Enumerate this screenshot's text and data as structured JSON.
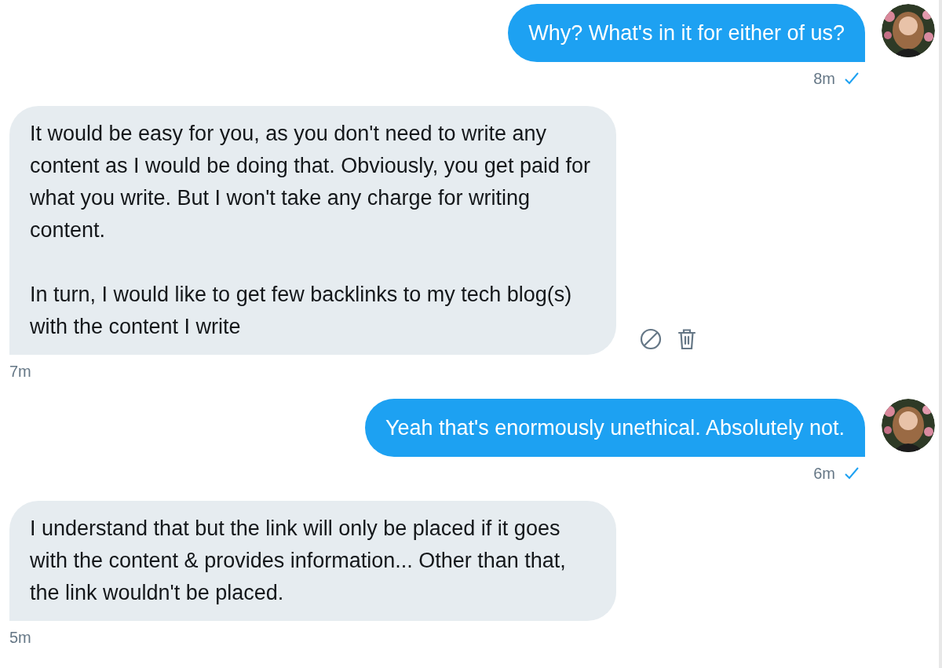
{
  "messages": [
    {
      "kind": "sent",
      "paragraphs": [
        "Why? What's in it for either of us?"
      ],
      "time": "8m",
      "read": true,
      "show_actions": false
    },
    {
      "kind": "received",
      "paragraphs": [
        "It would be easy for you, as you don't need to write any content as I would be doing that. Obviously, you get paid for what you write. But I won't take any charge for writing content.",
        "In turn, I would like to get few backlinks to my tech blog(s) with the content I write"
      ],
      "time": "7m",
      "show_actions": true
    },
    {
      "kind": "sent",
      "paragraphs": [
        "Yeah that's enormously unethical. Absolutely not."
      ],
      "time": "6m",
      "read": true,
      "show_actions": false
    },
    {
      "kind": "received",
      "paragraphs": [
        "I understand that but the link will only be placed if it goes with the content & provides information... Other than that, the link wouldn't be placed."
      ],
      "time": "5m",
      "show_actions": false
    }
  ]
}
